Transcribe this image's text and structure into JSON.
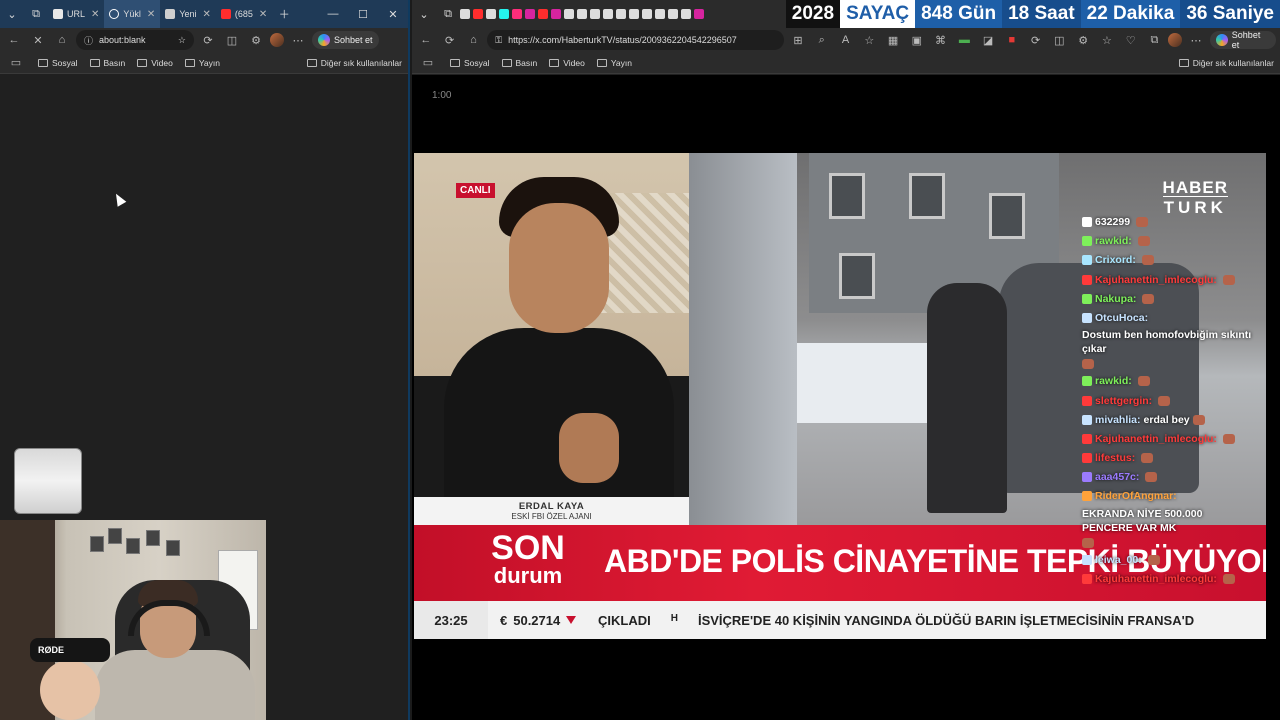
{
  "left_browser": {
    "tabs": [
      {
        "label": "URL",
        "favicon_color": "#e8e8e8"
      },
      {
        "label": "Yükl",
        "favicon_color": "#ffffff"
      },
      {
        "label": "Yeni",
        "favicon_color": "#cfcfcf"
      },
      {
        "label": "(685",
        "favicon_color": "#ff2d2d"
      }
    ],
    "address": "about:blank",
    "bookmarks": [
      "Sosyal",
      "Basın",
      "Video",
      "Yayın"
    ],
    "bookmarks_other": "Diğer sık kullanılanlar",
    "chat_button": "Sohbet et"
  },
  "webcam": {
    "mic_brand": "RØDE"
  },
  "right_browser": {
    "address": "https://x.com/HaberturkTV/status/2009362204542296507",
    "bookmarks": [
      "Sosyal",
      "Basın",
      "Video",
      "Yayın"
    ],
    "bookmarks_other": "Diğer sık kullanılanlar",
    "chat_button": "Sohbet et"
  },
  "counter": {
    "year": "2028",
    "label": "SAYAÇ",
    "days": "848 Gün",
    "hours": "18 Saat",
    "minutes": "22 Dakika",
    "seconds": "36 Saniye"
  },
  "video": {
    "time": "1:00",
    "live_badge": "CANLI",
    "guest_name": "ERDAL KAYA",
    "guest_title": "ESKİ FBI ÖZEL AJANI",
    "logo_line1": "HABER",
    "logo_line2": "TURK",
    "son_durum_1": "SON",
    "son_durum_2": "durum",
    "headline": "ABD'DE POLİS CİNAYETİNE TEPKİ BÜYÜYOR",
    "ticker_time": "23:25",
    "currency_symbol": "€",
    "currency_value": "50.2714",
    "ticker_text_1": "ÇIKLADI",
    "ticker_logo": "H",
    "ticker_text_2": "İSVİÇRE'DE 40 KİŞİNİN YANGINDA ÖLDÜĞÜ BARIN İŞLETMECİSİNİN FRANSA'D"
  },
  "chat": {
    "messages": [
      {
        "user": "632299",
        "text": "",
        "color": "#ffffff"
      },
      {
        "user": "rawkid:",
        "text": "",
        "color": "#7ef05a"
      },
      {
        "user": "Crixord:",
        "text": "",
        "color": "#a8e6ff"
      },
      {
        "user": "Kajuhanettin_imlecoglu:",
        "text": "",
        "color": "#ff3a3a"
      },
      {
        "user": "Nakupa:",
        "text": "",
        "color": "#7ef05a"
      },
      {
        "user": "OtcuHoca:",
        "text": "Dostum ben homofovbiğim sıkıntı çıkar",
        "color": "#c7e3ff"
      },
      {
        "user": "rawkid:",
        "text": "",
        "color": "#7ef05a"
      },
      {
        "user": "slettgergin:",
        "text": "",
        "color": "#ff3a3a"
      },
      {
        "user": "mivahlia:",
        "text": "erdal bey",
        "color": "#c7e3ff"
      },
      {
        "user": "Kajuhanettin_imlecoglu:",
        "text": "",
        "color": "#ff3a3a"
      },
      {
        "user": "lifestus:",
        "text": "",
        "color": "#ff3a3a"
      },
      {
        "user": "aaa457c:",
        "text": "",
        "color": "#9b7bff"
      },
      {
        "user": "RiderOfAngmar:",
        "text": "EKRANDA NİYE 500.000 PENCERE VAR MK",
        "color": "#ffa23a"
      },
      {
        "user": "leiwa_00:",
        "text": "",
        "color": "#c7e3ff"
      },
      {
        "user": "Kajuhanettin_imlecoglu:",
        "text": "",
        "color": "#ff3a3a"
      }
    ]
  }
}
